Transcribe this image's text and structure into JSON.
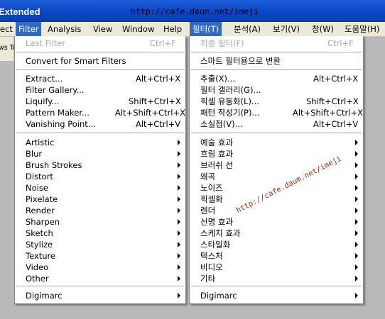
{
  "window": {
    "title": "Extended",
    "url_watermark": "http://cafe.daum.net/imeji"
  },
  "menubar": {
    "items": [
      "ect",
      "Filter",
      "Analysis",
      "View",
      "Window",
      "Help",
      "필터(T)",
      "분석(A)",
      "보기(V)",
      "창(W)",
      "도움말(H)"
    ]
  },
  "options_bar": {
    "fragment": "ws To"
  },
  "menu_en": {
    "last_filter": "Last Filter",
    "last_filter_sc": "Ctrl+F",
    "smart": "Convert for Smart Filters",
    "extract": "Extract...",
    "extract_sc": "Alt+Ctrl+X",
    "gallery": "Filter Gallery...",
    "liquify": "Liquify...",
    "liquify_sc": "Shift+Ctrl+X",
    "pattern": "Pattern Maker...",
    "pattern_sc": "Alt+Shift+Ctrl+X",
    "vanishing": "Vanishing Point...",
    "vanishing_sc": "Alt+Ctrl+V",
    "submenus": [
      "Artistic",
      "Blur",
      "Brush Strokes",
      "Distort",
      "Noise",
      "Pixelate",
      "Render",
      "Sharpen",
      "Sketch",
      "Stylize",
      "Texture",
      "Video",
      "Other"
    ],
    "digimarc": "Digimarc"
  },
  "menu_ko": {
    "last_filter": "최종 필터(F)",
    "last_filter_sc": "Ctrl+F",
    "smart": "스마트 필터용으로 변환",
    "extract": "추출(X)...",
    "extract_sc": "Alt+Ctrl+X",
    "gallery": "필터 갤러리(G)...",
    "liquify": "픽셀 유동화(L)...",
    "liquify_sc": "Shift+Ctrl+X",
    "pattern": "패턴 작성기(P)...",
    "pattern_sc": "Alt+Shift+Ctrl+X",
    "vanishing": "소실점(V)...",
    "vanishing_sc": "Alt+Ctrl+V",
    "submenus": [
      "예술 효과",
      "흐림 효과",
      "브러쉬 선",
      "왜곡",
      "노이즈",
      "픽셀화",
      "렌더",
      "선명 효과",
      "스케치 효과",
      "스타일화",
      "텍스처",
      "비디오",
      "기타"
    ],
    "digimarc": "Digimarc"
  },
  "watermark": "http://cafe.daum.net/imeji"
}
